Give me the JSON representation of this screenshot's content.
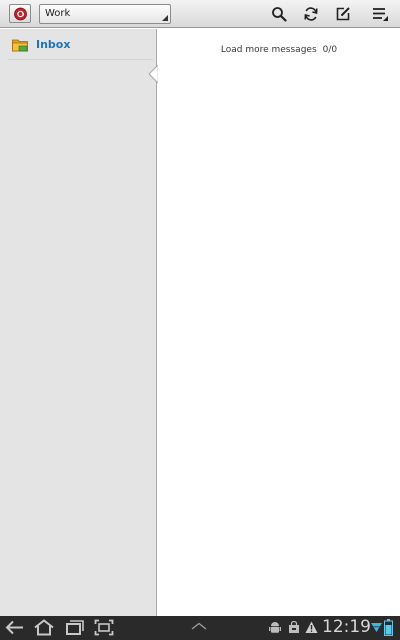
{
  "action_bar": {
    "app_icon": "email-app-icon",
    "account": "Work",
    "actions": [
      {
        "name": "search",
        "icon": "search-icon"
      },
      {
        "name": "refresh",
        "icon": "refresh-icon"
      },
      {
        "name": "compose",
        "icon": "compose-icon"
      },
      {
        "name": "menu",
        "icon": "overflow-menu-icon"
      }
    ]
  },
  "folders": [
    {
      "label": "Inbox",
      "icon": "folder-icon"
    }
  ],
  "message_list": {
    "load_more_label": "Load more messages",
    "count": "0/0"
  },
  "system_bar": {
    "time": "12:19",
    "nav_icons": [
      "back-icon",
      "home-icon",
      "recent-apps-icon",
      "screenshot-icon",
      "up-arrow-icon"
    ],
    "status_icons": [
      "android-debug-icon",
      "shopping-bag-icon",
      "warning-icon",
      "wifi-icon",
      "battery-icon"
    ]
  },
  "colors": {
    "folder_label": "#1f74b8",
    "folder_pane_bg": "#e4e4e4",
    "system_bar_bg": "#2a2a2a",
    "app_icon_red": "#c0202a"
  }
}
